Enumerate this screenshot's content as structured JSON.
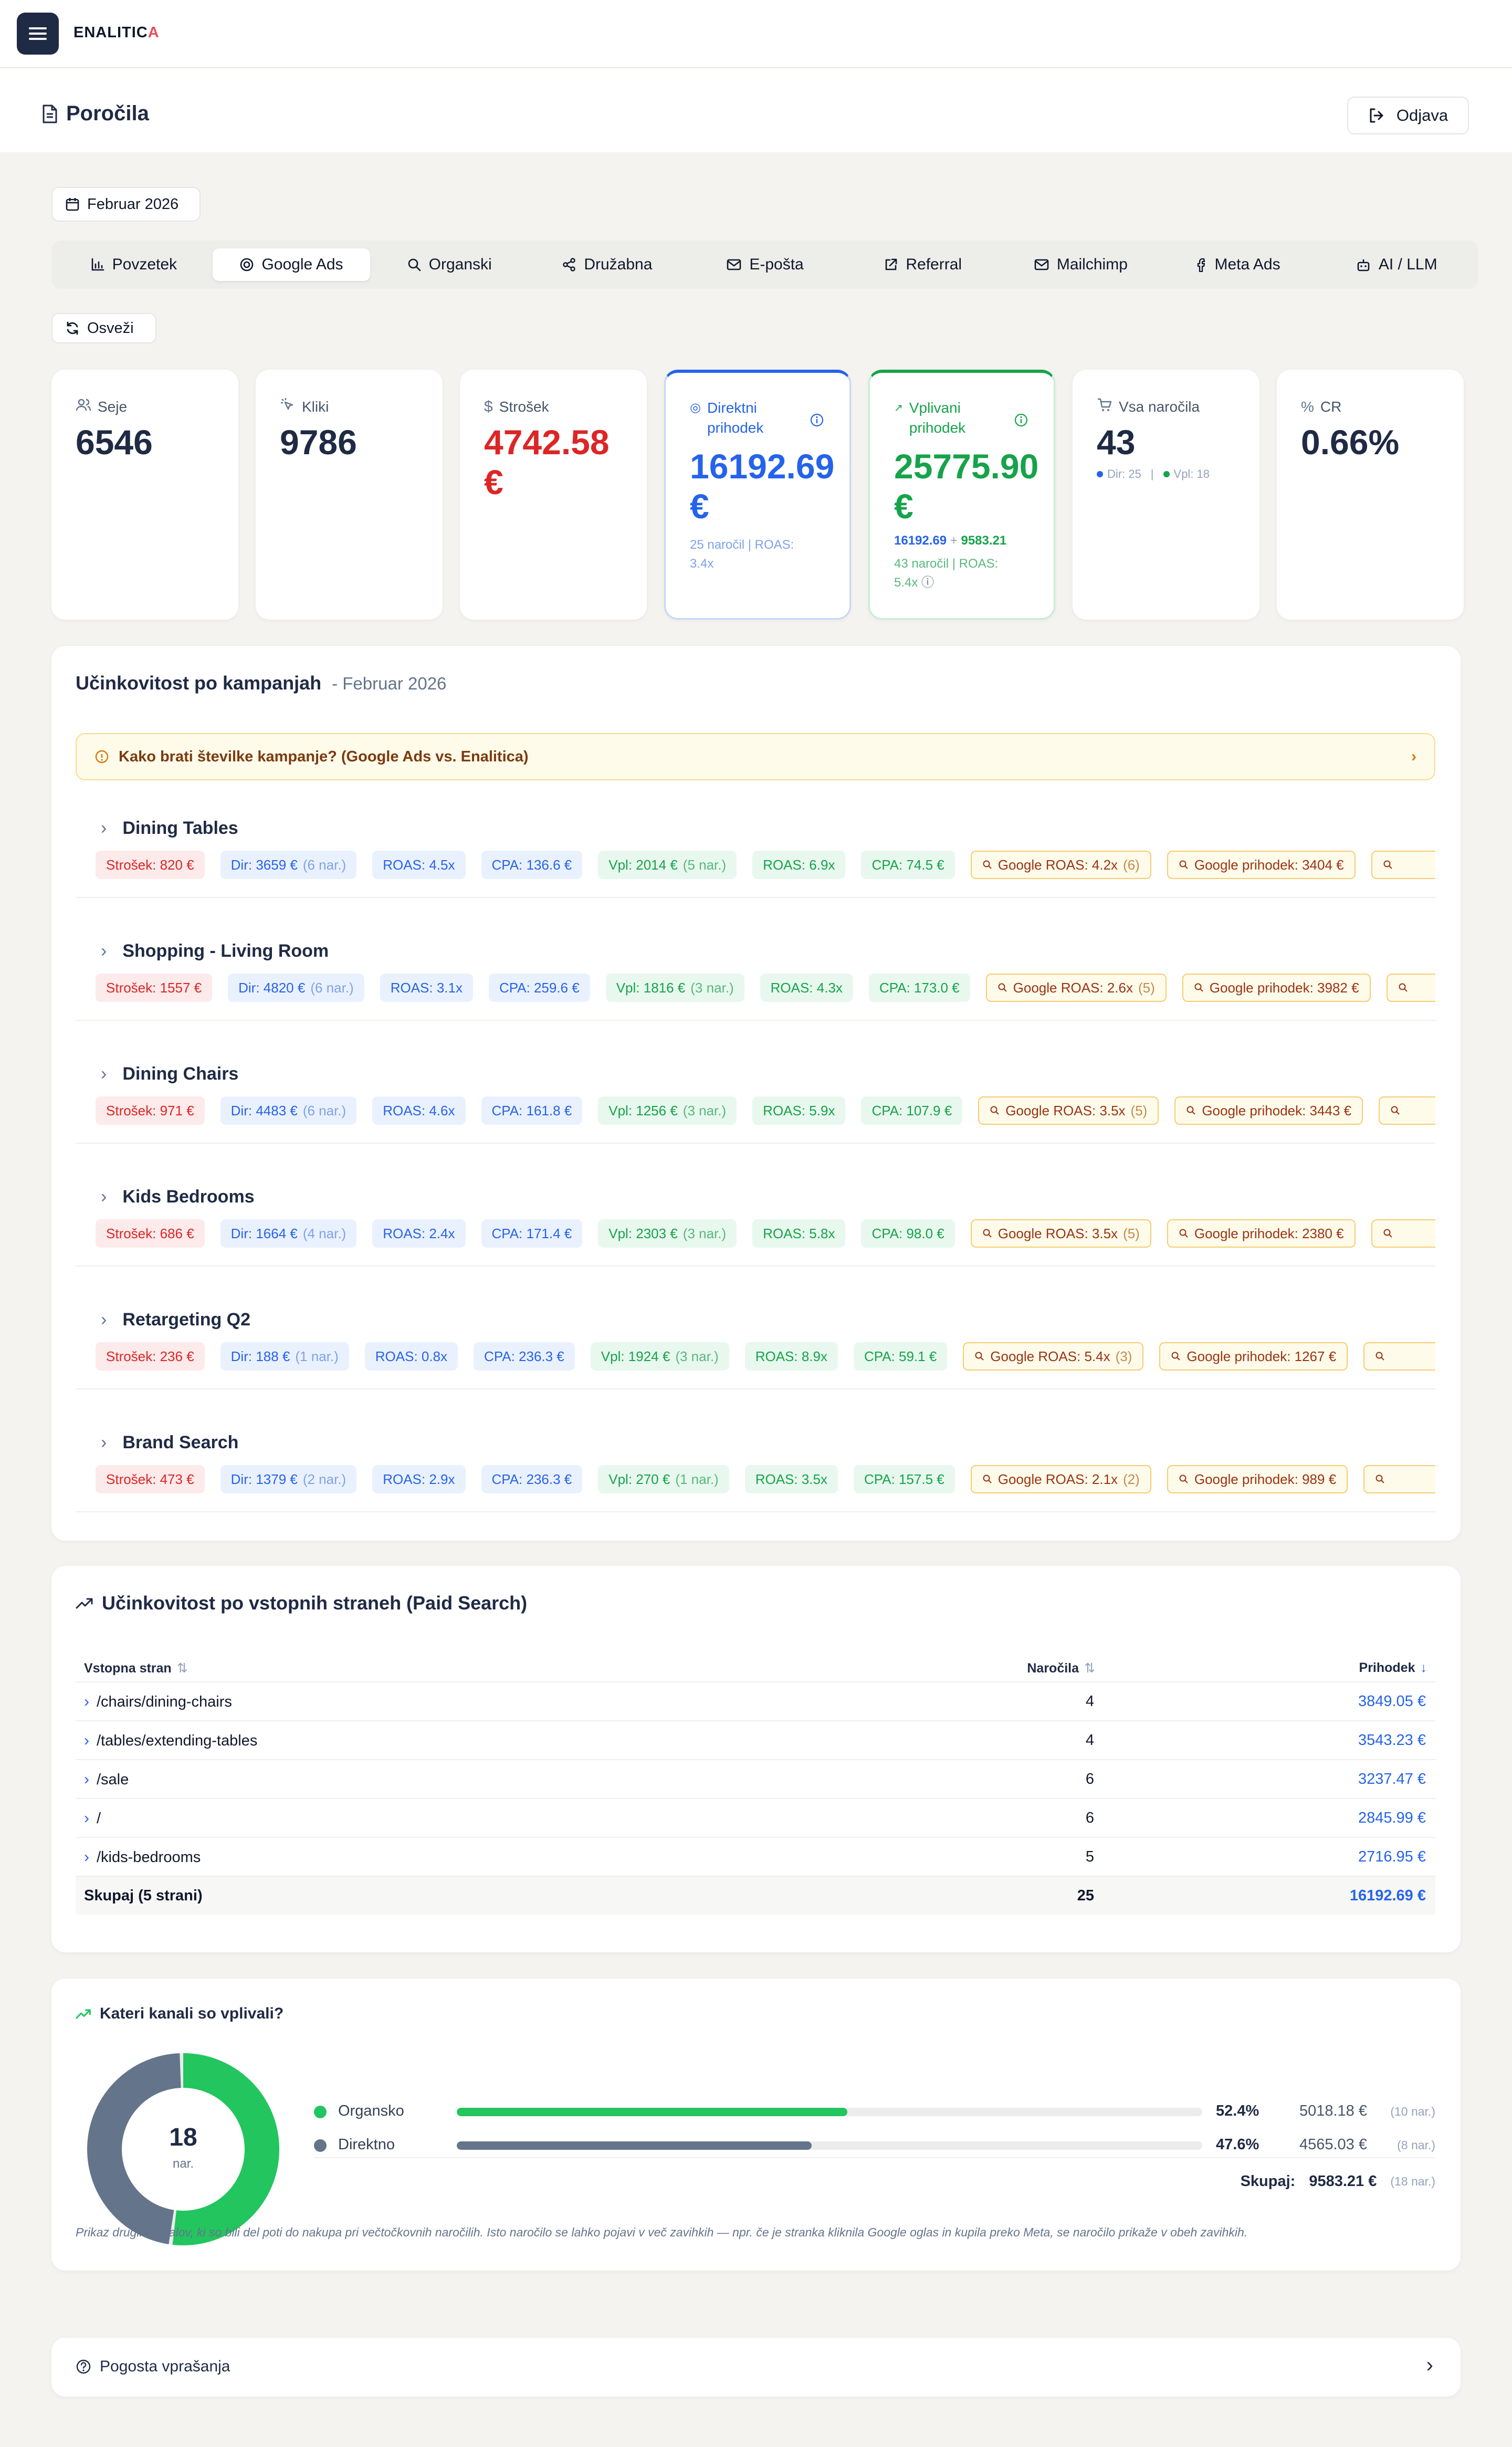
{
  "brand": {
    "logo_text": "ENALITIC",
    "logo_accent": "A"
  },
  "header": {
    "title": "Poročila",
    "logout_label": "Odjava"
  },
  "period_label": "Februar 2026",
  "tabs": [
    {
      "label": "Povzetek",
      "icon": "bar-chart-icon",
      "active": false
    },
    {
      "label": "Google Ads",
      "icon": "google-icon",
      "active": true
    },
    {
      "label": "Organski",
      "icon": "search-icon",
      "active": false
    },
    {
      "label": "Družabna",
      "icon": "share-icon",
      "active": false
    },
    {
      "label": "E-pošta",
      "icon": "mail-icon",
      "active": false
    },
    {
      "label": "Referral",
      "icon": "external-link-icon",
      "active": false
    },
    {
      "label": "Mailchimp",
      "icon": "mail-icon",
      "active": false
    },
    {
      "label": "Meta Ads",
      "icon": "facebook-icon",
      "active": false
    },
    {
      "label": "AI / LLM",
      "icon": "robot-icon",
      "active": false
    }
  ],
  "refresh_label": "Osveži",
  "kpis": {
    "sessions": {
      "label": "Seje",
      "value": "6546"
    },
    "clicks": {
      "label": "Kliki",
      "value": "9786"
    },
    "cost": {
      "label": "Strošek",
      "value": "4742.58 €"
    },
    "direct": {
      "label": "Direktni prihodek",
      "value": "16192.69 €",
      "sub": "25 naročil | ROAS: 3.4x"
    },
    "influenced": {
      "label": "Vplivani prihodek",
      "value": "25775.90 €",
      "sum_a": "16192.69",
      "plus": "+",
      "sum_b": "9583.21",
      "sub": "43 naročil | ROAS: 5.4x"
    },
    "orders": {
      "label": "Vsa naročila",
      "value": "43",
      "dir": "Dir: 25",
      "sep": "|",
      "vpl": "Vpl: 18"
    },
    "cr": {
      "label": "CR",
      "value": "0.66%"
    }
  },
  "campaigns_section": {
    "title": "Učinkovitost po kampanjah",
    "period": "- Februar 2026",
    "note": "Kako brati številke kampanje? (Google Ads vs. Enalitica)",
    "items": [
      {
        "name": "Dining Tables",
        "cost": "Strošek: 820 €",
        "dir": "Dir: 3659 €",
        "dir_n": "(6 nar.)",
        "roas": "ROAS: 4.5x",
        "cpa": "CPA: 136.6 €",
        "vpl": "Vpl: 2014 €",
        "vpl_n": "(5 nar.)",
        "vroas": "ROAS: 6.9x",
        "vcpa": "CPA: 74.5 €",
        "groas": "Google ROAS: 4.2x",
        "groas_n": "(6)",
        "grev": "Google prihodek: 3404 €"
      },
      {
        "name": "Shopping - Living Room",
        "cost": "Strošek: 1557 €",
        "dir": "Dir: 4820 €",
        "dir_n": "(6 nar.)",
        "roas": "ROAS: 3.1x",
        "cpa": "CPA: 259.6 €",
        "vpl": "Vpl: 1816 €",
        "vpl_n": "(3 nar.)",
        "vroas": "ROAS: 4.3x",
        "vcpa": "CPA: 173.0 €",
        "groas": "Google ROAS: 2.6x",
        "groas_n": "(5)",
        "grev": "Google prihodek: 3982 €"
      },
      {
        "name": "Dining Chairs",
        "cost": "Strošek: 971 €",
        "dir": "Dir: 4483 €",
        "dir_n": "(6 nar.)",
        "roas": "ROAS: 4.6x",
        "cpa": "CPA: 161.8 €",
        "vpl": "Vpl: 1256 €",
        "vpl_n": "(3 nar.)",
        "vroas": "ROAS: 5.9x",
        "vcpa": "CPA: 107.9 €",
        "groas": "Google ROAS: 3.5x",
        "groas_n": "(5)",
        "grev": "Google prihodek: 3443 €"
      },
      {
        "name": "Kids Bedrooms",
        "cost": "Strošek: 686 €",
        "dir": "Dir: 1664 €",
        "dir_n": "(4 nar.)",
        "roas": "ROAS: 2.4x",
        "cpa": "CPA: 171.4 €",
        "vpl": "Vpl: 2303 €",
        "vpl_n": "(3 nar.)",
        "vroas": "ROAS: 5.8x",
        "vcpa": "CPA: 98.0 €",
        "groas": "Google ROAS: 3.5x",
        "groas_n": "(5)",
        "grev": "Google prihodek: 2380 €"
      },
      {
        "name": "Retargeting Q2",
        "cost": "Strošek: 236 €",
        "dir": "Dir: 188 €",
        "dir_n": "(1 nar.)",
        "roas": "ROAS: 0.8x",
        "cpa": "CPA: 236.3 €",
        "vpl": "Vpl: 1924 €",
        "vpl_n": "(3 nar.)",
        "vroas": "ROAS: 8.9x",
        "vcpa": "CPA: 59.1 €",
        "groas": "Google ROAS: 5.4x",
        "groas_n": "(3)",
        "grev": "Google prihodek: 1267 €"
      },
      {
        "name": "Brand Search",
        "cost": "Strošek: 473 €",
        "dir": "Dir: 1379 €",
        "dir_n": "(2 nar.)",
        "roas": "ROAS: 2.9x",
        "cpa": "CPA: 236.3 €",
        "vpl": "Vpl: 270 €",
        "vpl_n": "(1 nar.)",
        "vroas": "ROAS: 3.5x",
        "vcpa": "CPA: 157.5 €",
        "groas": "Google ROAS: 2.1x",
        "groas_n": "(2)",
        "grev": "Google prihodek: 989 €"
      }
    ]
  },
  "landing_section": {
    "title": "Učinkovitost po vstopnih straneh (Paid Search)",
    "col_page": "Vstopna stran",
    "col_orders": "Naročila",
    "col_revenue": "Prihodek",
    "rows": [
      {
        "page": "/chairs/dining-chairs",
        "orders": "4",
        "revenue": "3849.05 €"
      },
      {
        "page": "/tables/extending-tables",
        "orders": "4",
        "revenue": "3543.23 €"
      },
      {
        "page": "/sale",
        "orders": "6",
        "revenue": "3237.47 €"
      },
      {
        "page": "/",
        "orders": "6",
        "revenue": "2845.99 €"
      },
      {
        "page": "/kids-bedrooms",
        "orders": "5",
        "revenue": "2716.95 €"
      }
    ],
    "total": {
      "label": "Skupaj (5 strani)",
      "orders": "25",
      "revenue": "16192.69 €"
    }
  },
  "channels_section": {
    "title": "Kateri kanali so vplivali?",
    "donut_value": "18",
    "donut_unit": "nar.",
    "colors": {
      "organic": "#22c55e",
      "direct": "#64748b"
    },
    "rows": [
      {
        "name": "Organsko",
        "pct": "52.4%",
        "fraction": 0.524,
        "eur": "5018.18 €",
        "count": "(10 nar.)"
      },
      {
        "name": "Direktno",
        "pct": "47.6%",
        "fraction": 0.476,
        "eur": "4565.03 €",
        "count": "(8 nar.)"
      }
    ],
    "total_label": "Skupaj:",
    "total_value": "9583.21 €",
    "total_count": "(18 nar.)",
    "footnote": "Prikaz drugih kanalov, ki so bili del poti do nakupa pri večtočkovnih naročilih. Isto naročilo se lahko pojavi v več zavihkih — npr. če je stranka kliknila Google oglas in kupila preko Meta, se naročilo prikaže v obeh zavihkih."
  },
  "faq_label": "Pogosta vprašanja"
}
